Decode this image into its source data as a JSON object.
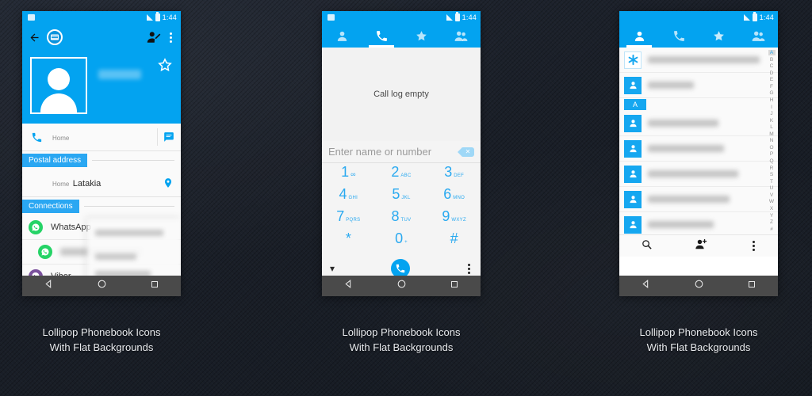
{
  "background": {
    "color": "#1b2029",
    "accent": "#03A3F0"
  },
  "status_bar": {
    "time": "1:44",
    "signal_icon": "signal-icon",
    "battery_icon": "battery-icon"
  },
  "phone1": {
    "appbar": {
      "back_icon": "back-arrow-icon",
      "account_badge_icon": "contacts-badge-icon",
      "edit_icon": "edit-contact-icon",
      "overflow_icon": "overflow-menu-icon"
    },
    "hero": {
      "avatar_icon": "contact-avatar-icon",
      "favorite_icon": "star-outline-icon",
      "name_redacted": ""
    },
    "phone_row": {
      "call_icon": "phone-icon",
      "label": "Home",
      "number_redacted": "",
      "message_icon": "message-icon"
    },
    "postal_section": {
      "header": "Postal address",
      "label": "Home",
      "value": "Latakia",
      "map_icon": "location-pin-icon"
    },
    "connections_section": {
      "header": "Connections",
      "items": [
        {
          "label": "WhatsApp",
          "icon": "whatsapp-icon",
          "color": "#25D366"
        },
        {
          "label": "",
          "icon": "whatsapp-icon",
          "color": "#25D366"
        },
        {
          "label": "Viber",
          "icon": "viber-icon",
          "color": "#7B519D"
        },
        {
          "label": "",
          "icon": "viber-icon",
          "color": "#7B519D"
        }
      ]
    }
  },
  "phone2": {
    "tabs": [
      {
        "label": "",
        "icon": "person-icon",
        "active": false
      },
      {
        "label": "",
        "icon": "phone-icon",
        "active": true
      },
      {
        "label": "",
        "icon": "star-icon",
        "active": false
      },
      {
        "label": "",
        "icon": "groups-icon",
        "active": false
      }
    ],
    "call_log": {
      "empty_text": "Call log empty"
    },
    "dial_input": {
      "placeholder": "Enter name or number",
      "value": "",
      "backspace_icon": "backspace-icon"
    },
    "keypad": [
      {
        "num": "1",
        "sub": "∞",
        "voicemail": true
      },
      {
        "num": "2",
        "sub": "ABC"
      },
      {
        "num": "3",
        "sub": "DEF"
      },
      {
        "num": "4",
        "sub": "GHI"
      },
      {
        "num": "5",
        "sub": "JKL"
      },
      {
        "num": "6",
        "sub": "MNO"
      },
      {
        "num": "7",
        "sub": "PQRS"
      },
      {
        "num": "8",
        "sub": "TUV"
      },
      {
        "num": "9",
        "sub": "WXYZ"
      },
      {
        "num": "*",
        "sub": ""
      },
      {
        "num": "0",
        "sub": "+"
      },
      {
        "num": "#",
        "sub": ""
      }
    ],
    "actions": {
      "collapse_icon": "chevron-down-icon",
      "call_icon": "call-button-icon",
      "overflow_icon": "overflow-menu-icon"
    }
  },
  "phone3": {
    "tabs": [
      {
        "label": "",
        "icon": "person-icon",
        "active": true
      },
      {
        "label": "",
        "icon": "phone-icon",
        "active": false
      },
      {
        "label": "",
        "icon": "star-icon",
        "active": false
      },
      {
        "label": "",
        "icon": "groups-icon",
        "active": false
      }
    ],
    "contacts": [
      {
        "icon": "emergency-star-of-life-icon",
        "tile": "white",
        "name_redacted": "",
        "width": "82%"
      },
      {
        "icon": "person-icon",
        "tile": "blue",
        "name_redacted": "",
        "width": "34%"
      },
      {
        "icon": "person-icon",
        "tile": "blue",
        "name_redacted": "",
        "width": "52%"
      },
      {
        "icon": "person-icon",
        "tile": "blue",
        "name_redacted": "",
        "width": "56%"
      },
      {
        "icon": "person-icon",
        "tile": "blue",
        "name_redacted": "",
        "width": "66%"
      },
      {
        "icon": "person-icon",
        "tile": "blue",
        "name_redacted": "",
        "width": "60%"
      },
      {
        "icon": "person-icon",
        "tile": "blue",
        "name_redacted": "",
        "width": "48%"
      },
      {
        "icon": "person-icon",
        "tile": "blue",
        "name_redacted": "",
        "width": "38%"
      }
    ],
    "section_header": "A",
    "alpha_index": [
      "A",
      "B",
      "C",
      "D",
      "E",
      "F",
      "G",
      "H",
      "I",
      "J",
      "K",
      "L",
      "M",
      "N",
      "O",
      "P",
      "Q",
      "R",
      "S",
      "T",
      "U",
      "V",
      "W",
      "X",
      "Y",
      "Z",
      "#"
    ],
    "alpha_active": "A",
    "bottom_bar": {
      "search_icon": "search-icon",
      "add_contact_icon": "add-contact-icon",
      "overflow_icon": "overflow-menu-icon"
    }
  },
  "navbar": {
    "back_icon": "nav-back-icon",
    "home_icon": "nav-home-icon",
    "recents_icon": "nav-recents-icon"
  },
  "captions": {
    "line1": "Lollipop Phonebook Icons",
    "line2": "With Flat Backgrounds"
  }
}
